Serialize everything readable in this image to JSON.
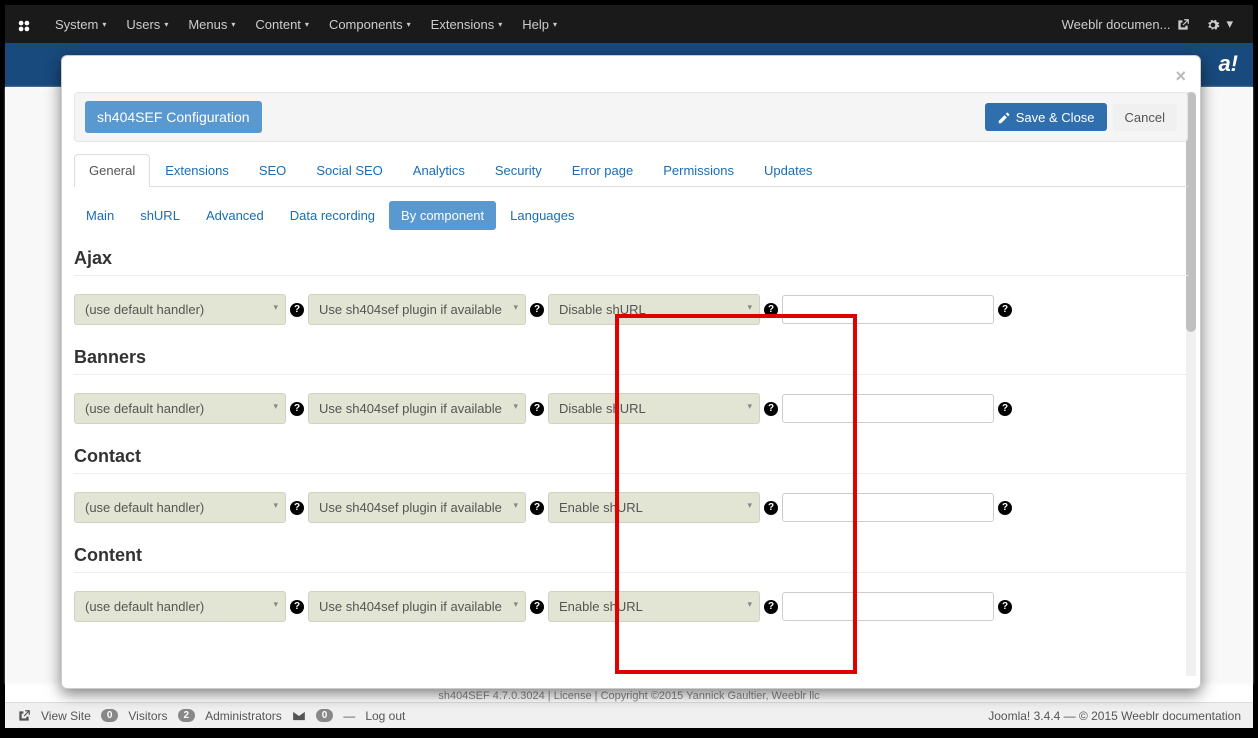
{
  "topnav": {
    "items": [
      "System",
      "Users",
      "Menus",
      "Content",
      "Components",
      "Extensions",
      "Help"
    ],
    "right_label": "Weeblr documen..."
  },
  "modal": {
    "title": "sh404SEF Configuration",
    "save_label": "Save & Close",
    "cancel_label": "Cancel"
  },
  "tabs_main": [
    "General",
    "Extensions",
    "SEO",
    "Social SEO",
    "Analytics",
    "Security",
    "Error page",
    "Permissions",
    "Updates"
  ],
  "tabs_main_active": 0,
  "subtabs": [
    "Main",
    "shURL",
    "Advanced",
    "Data recording",
    "By component",
    "Languages"
  ],
  "subtabs_active": 4,
  "sel_options": {
    "handler": "(use default handler)",
    "plugin": "Use sh404sef plugin if available",
    "disable_shurl": "Disable shURL",
    "enable_shurl": "Enable shURL"
  },
  "sections": [
    {
      "title": "Ajax",
      "col3": "disable_shurl"
    },
    {
      "title": "Banners",
      "col3": "disable_shurl"
    },
    {
      "title": "Contact",
      "col3": "enable_shurl"
    },
    {
      "title": "Content",
      "col3": "enable_shurl"
    }
  ],
  "footer1": "sh404SEF 4.7.0.3024 | License | Copyright ©2015 Yannick Gaultier, Weeblr llc",
  "footer2": {
    "view_site": "View Site",
    "visitors": "Visitors",
    "visitors_count": "0",
    "admins": "Administrators",
    "admins_count": "2",
    "msgs_count": "0",
    "logout": "Log out",
    "right": "Joomla! 3.4.4 — © 2015 Weeblr documentation"
  }
}
